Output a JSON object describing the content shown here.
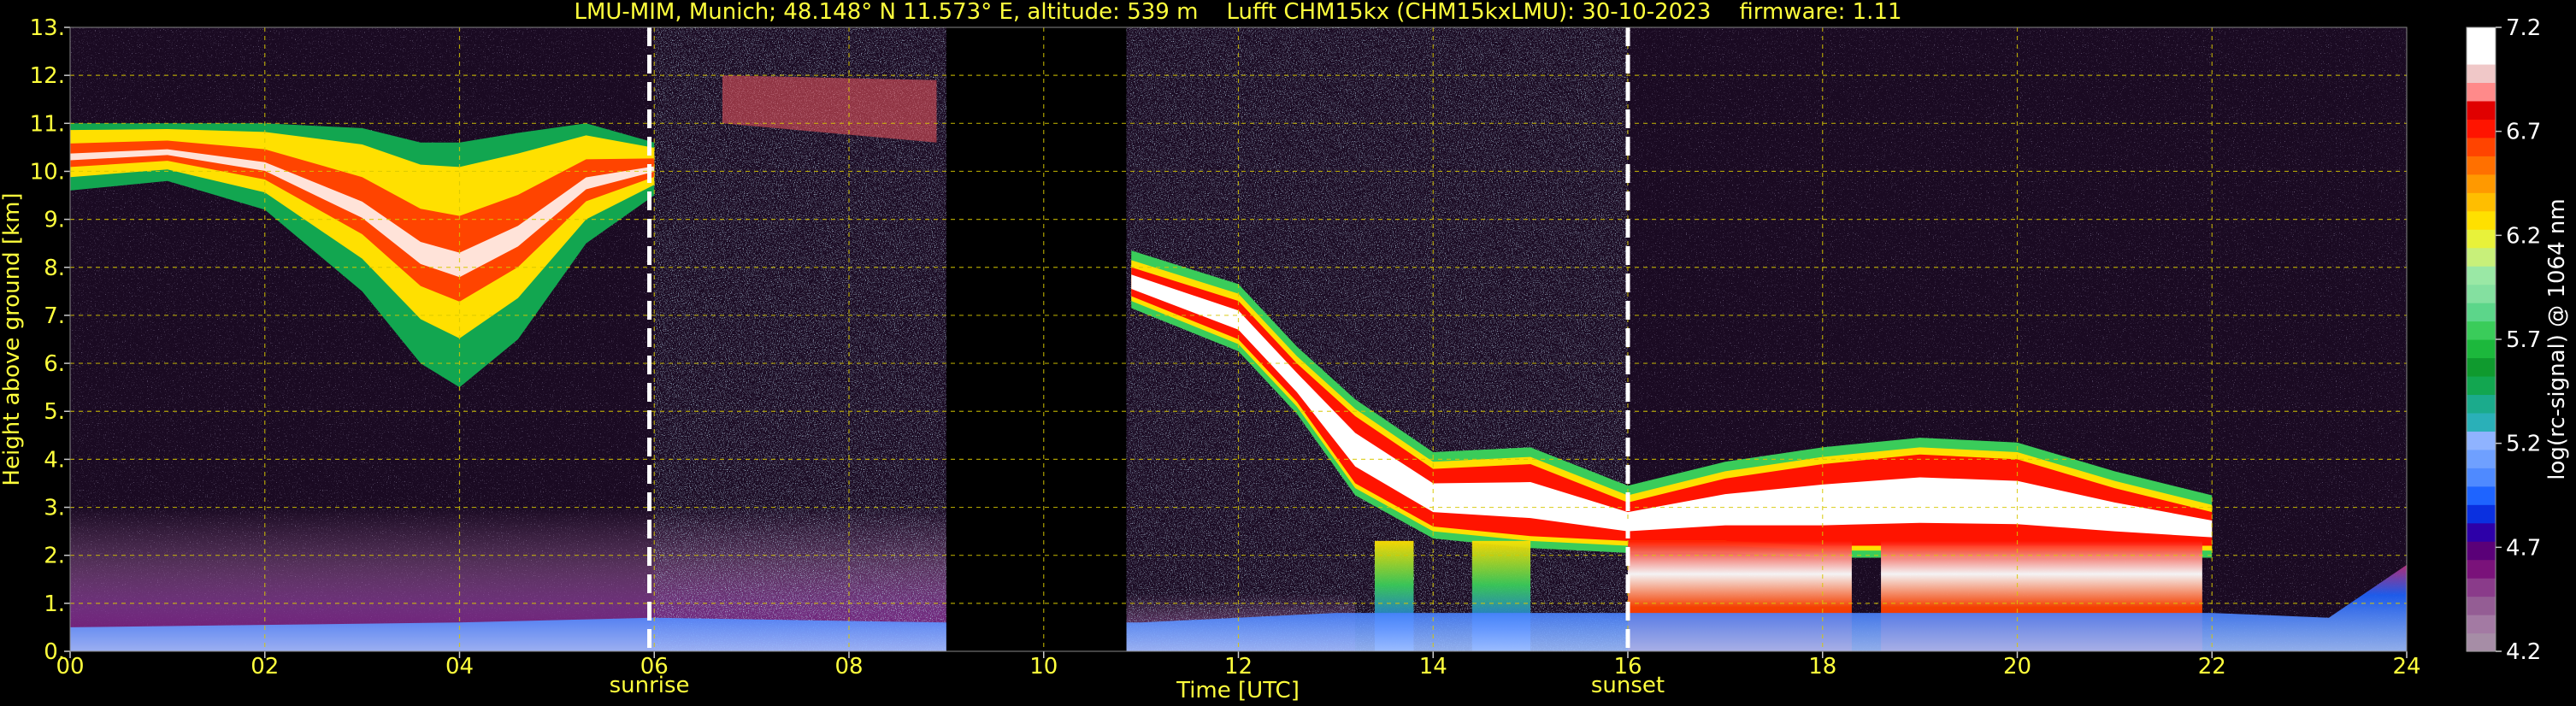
{
  "chart_data": {
    "type": "heatmap",
    "title": "LMU-MIM, Munich; 48.148° N 11.573° E, altitude: 539 m    Lufft CHM15kx (CHM15kxLMU): 30-10-2023    firmware: 1.11",
    "xlabel": "Time [UTC]",
    "ylabel": "Height above ground [km]",
    "xlim": [
      0,
      24
    ],
    "ylim": [
      0,
      13
    ],
    "x_ticks": [
      "00",
      "02",
      "04",
      "06",
      "08",
      "10",
      "12",
      "14",
      "16",
      "18",
      "20",
      "22",
      "24"
    ],
    "y_ticks": [
      "0.",
      "1.",
      "2.",
      "3.",
      "4.",
      "5.",
      "6.",
      "7.",
      "8.",
      "9.",
      "10.",
      "11.",
      "12.",
      "13."
    ],
    "grid": true,
    "no_data_gap": [
      9.0,
      10.85
    ],
    "annotations": [
      {
        "label": "sunrise",
        "x": 5.95
      },
      {
        "label": "sunset",
        "x": 16.0
      }
    ],
    "colorbar": {
      "label": "log(rc-signal) @ 1064 nm",
      "range": [
        4.2,
        7.2
      ],
      "ticks": [
        "4.2",
        "4.7",
        "5.2",
        "5.7",
        "6.2",
        "6.7",
        "7.2"
      ],
      "colors": [
        "#a68da6",
        "#a37aa3",
        "#945d94",
        "#8a3b8a",
        "#7a127a",
        "#5a0078",
        "#2d00a8",
        "#0a30e0",
        "#1e64ff",
        "#4f8aff",
        "#6fa0ff",
        "#8fb3ff",
        "#2ab0b8",
        "#1bab8c",
        "#12a650",
        "#0f9a2e",
        "#1cb83c",
        "#3acc5a",
        "#5cd68a",
        "#84e0a0",
        "#9ae8a5",
        "#c8f07a",
        "#e8f23a",
        "#ffe000",
        "#ffbe00",
        "#ff9900",
        "#ff7000",
        "#ff4400",
        "#ff1400",
        "#e00000",
        "#ff8a8a",
        "#f0c8c8",
        "#ffffff",
        "#ffffff"
      ]
    },
    "cirrus_layer": [
      {
        "t": 0.0,
        "base": 9.6,
        "top": 11.0
      },
      {
        "t": 1.0,
        "base": 9.8,
        "top": 11.0
      },
      {
        "t": 2.0,
        "base": 9.2,
        "top": 11.0
      },
      {
        "t": 3.0,
        "base": 7.5,
        "top": 10.9
      },
      {
        "t": 3.6,
        "base": 6.0,
        "top": 10.6
      },
      {
        "t": 4.0,
        "base": 5.5,
        "top": 10.6
      },
      {
        "t": 4.6,
        "base": 6.5,
        "top": 10.8
      },
      {
        "t": 5.3,
        "base": 8.5,
        "top": 11.0
      },
      {
        "t": 6.0,
        "base": 9.5,
        "top": 10.6
      }
    ],
    "upper_cloud": [
      {
        "t": 6.7,
        "base": 11.0,
        "top": 12.0
      },
      {
        "t": 8.9,
        "base": 10.6,
        "top": 11.9
      }
    ],
    "descending_cloud_base": [
      {
        "t": 10.9,
        "base": 7.4,
        "top": 8.0
      },
      {
        "t": 12.0,
        "base": 6.5,
        "top": 7.3
      },
      {
        "t": 12.6,
        "base": 5.2,
        "top": 6.0
      },
      {
        "t": 13.2,
        "base": 3.5,
        "top": 4.9
      },
      {
        "t": 14.0,
        "base": 2.6,
        "top": 3.8
      },
      {
        "t": 15.0,
        "base": 2.4,
        "top": 3.9
      },
      {
        "t": 16.0,
        "base": 2.3,
        "top": 3.1
      },
      {
        "t": 17.0,
        "base": 2.3,
        "top": 3.6
      },
      {
        "t": 18.0,
        "base": 2.2,
        "top": 3.9
      },
      {
        "t": 19.0,
        "base": 2.2,
        "top": 4.1
      },
      {
        "t": 20.0,
        "base": 2.2,
        "top": 4.0
      },
      {
        "t": 21.0,
        "base": 2.2,
        "top": 3.4
      },
      {
        "t": 22.0,
        "base": 2.2,
        "top": 2.9
      }
    ],
    "precipitation": [
      {
        "start": 13.4,
        "end": 13.8
      },
      {
        "start": 14.4,
        "end": 15.0
      },
      {
        "start": 16.0,
        "end": 18.3
      },
      {
        "start": 18.6,
        "end": 21.9
      }
    ],
    "boundary_layer_top": [
      {
        "t": 0.0,
        "h": 0.5
      },
      {
        "t": 4.0,
        "h": 0.6
      },
      {
        "t": 6.0,
        "h": 0.7
      },
      {
        "t": 9.0,
        "h": 0.6
      },
      {
        "t": 11.0,
        "h": 0.6
      },
      {
        "t": 13.0,
        "h": 0.8
      },
      {
        "t": 22.0,
        "h": 0.8
      },
      {
        "t": 23.2,
        "h": 0.7
      },
      {
        "t": 24.0,
        "h": 1.8
      }
    ]
  }
}
